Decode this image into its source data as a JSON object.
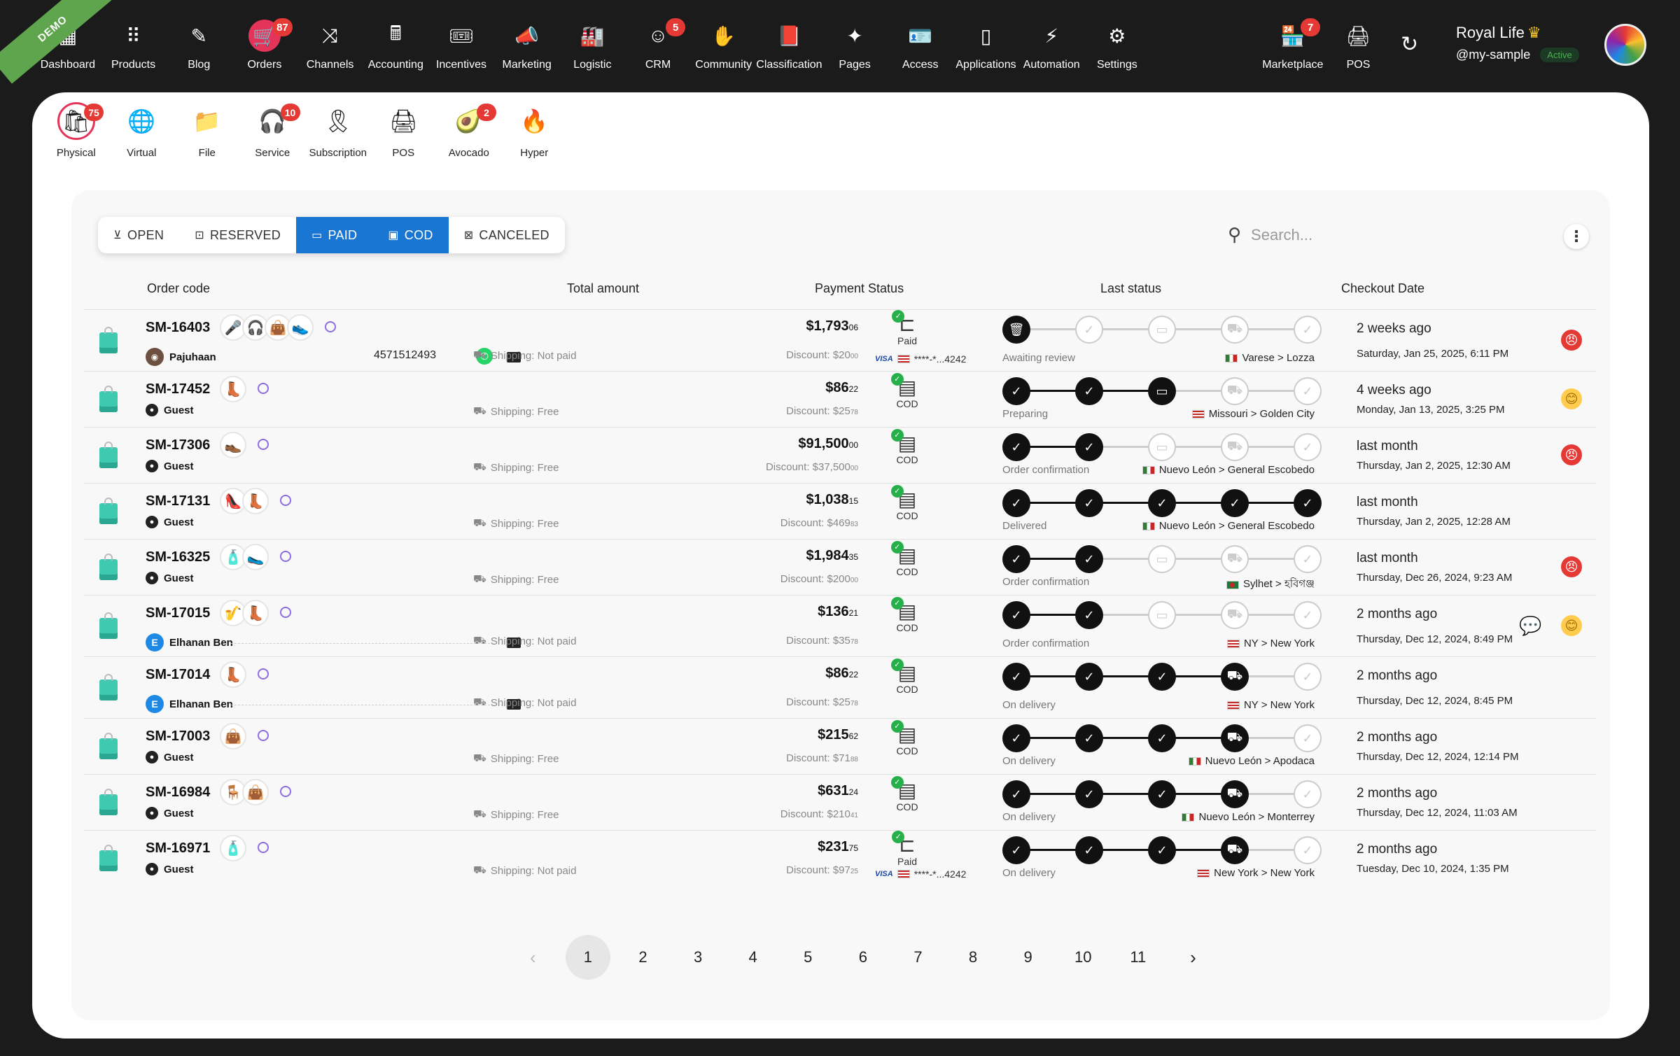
{
  "demo_label": "DEMO",
  "nav": [
    {
      "label": "Dashboard",
      "icon": "dashboard-icon",
      "glyph": "▦"
    },
    {
      "label": "Products",
      "icon": "products-icon",
      "glyph": "⠿"
    },
    {
      "label": "Blog",
      "icon": "blog-icon",
      "glyph": "✎"
    },
    {
      "label": "Orders",
      "icon": "cart-icon",
      "glyph": "🛒",
      "badge": "87",
      "active": true
    },
    {
      "label": "Channels",
      "icon": "channels-icon",
      "glyph": "⤨"
    },
    {
      "label": "Accounting",
      "icon": "calculator-icon",
      "glyph": "🖩"
    },
    {
      "label": "Incentives",
      "icon": "ticket-icon",
      "glyph": "🎟"
    },
    {
      "label": "Marketing",
      "icon": "megaphone-icon",
      "glyph": "📣"
    },
    {
      "label": "Logistic",
      "icon": "warehouse-icon",
      "glyph": "🏭"
    },
    {
      "label": "CRM",
      "icon": "crm-icon",
      "glyph": "☺",
      "badge": "5"
    },
    {
      "label": "Community",
      "icon": "community-icon",
      "glyph": "✋"
    },
    {
      "label": "Classification",
      "icon": "book-icon",
      "glyph": "📕"
    },
    {
      "label": "Pages",
      "icon": "pages-icon",
      "glyph": "✦"
    },
    {
      "label": "Access",
      "icon": "access-icon",
      "glyph": "🪪"
    },
    {
      "label": "Applications",
      "icon": "phone-icon",
      "glyph": "▯"
    },
    {
      "label": "Automation",
      "icon": "automation-icon",
      "glyph": "⚡"
    },
    {
      "label": "Settings",
      "icon": "gear-icon",
      "glyph": "⚙"
    }
  ],
  "nav_right": [
    {
      "label": "Marketplace",
      "icon": "marketplace-icon",
      "glyph": "🏪",
      "badge": "7"
    },
    {
      "label": "POS",
      "icon": "pos-icon",
      "glyph": "🖨"
    }
  ],
  "user": {
    "name": "Royal Life",
    "handle": "@my-sample",
    "status": "Active"
  },
  "subnav": [
    {
      "label": "Physical",
      "icon": "physical-icon",
      "glyph": "🛍",
      "badge": "75",
      "active": true
    },
    {
      "label": "Virtual",
      "icon": "globe-icon",
      "glyph": "🌐"
    },
    {
      "label": "File",
      "icon": "file-icon",
      "glyph": "📁"
    },
    {
      "label": "Service",
      "icon": "headset-icon",
      "glyph": "🎧",
      "badge": "10"
    },
    {
      "label": "Subscription",
      "icon": "ribbon-icon",
      "glyph": "🎗"
    },
    {
      "label": "POS",
      "icon": "pos-terminal-icon",
      "glyph": "🖨"
    },
    {
      "label": "Avocado",
      "icon": "avocado-icon",
      "glyph": "🥑",
      "badge": "2"
    },
    {
      "label": "Hyper",
      "icon": "hyper-icon",
      "glyph": "🔥"
    }
  ],
  "filters": [
    {
      "label": "OPEN",
      "icon": "inbox-icon",
      "glyph": "⊻",
      "active": false
    },
    {
      "label": "RESERVED",
      "icon": "reserved-icon",
      "glyph": "⊡",
      "active": false
    },
    {
      "label": "PAID",
      "icon": "credit-card-icon",
      "glyph": "▭",
      "active": true
    },
    {
      "label": "COD",
      "icon": "cash-icon",
      "glyph": "▣",
      "active": true
    },
    {
      "label": "CANCELED",
      "icon": "cancel-icon",
      "glyph": "⊠",
      "active": false
    }
  ],
  "search": {
    "placeholder": "Search..."
  },
  "columns": {
    "order": "Order code",
    "amount": "Total amount",
    "payment": "Payment Status",
    "status": "Last status",
    "date": "Checkout Date"
  },
  "orders": [
    {
      "code": "SM-16403",
      "thumbs": [
        "🎤",
        "🎧",
        "👜",
        "👟"
      ],
      "customer": "Pajuhaan",
      "cust_type": "photo",
      "phone": "4571512493",
      "whatsapp": true,
      "mail": true,
      "shipping": "Shipping: Not paid",
      "amount": "$1,793",
      "amount_cents": "06",
      "discount": "Discount: $20",
      "discount_cents": "00",
      "payment": "Paid",
      "card": "****-*...4242",
      "steps_done": 1,
      "active_step": 1,
      "status": "Awaiting review",
      "flag": "it",
      "route": "Varese > Lozza",
      "ago": "2 weeks ago",
      "date": "Saturday, Jan 25, 2025, 6:11 PM",
      "mood": "angry",
      "chat": false
    },
    {
      "code": "SM-17452",
      "thumbs": [
        "👢"
      ],
      "customer": "Guest",
      "cust_type": "guest",
      "shipping": "Shipping: Free",
      "amount": "$86",
      "amount_cents": "22",
      "discount": "Discount: $25",
      "discount_cents": "78",
      "payment": "COD",
      "steps_done": 3,
      "active_step": 3,
      "status": "Preparing",
      "flag": "us",
      "route": "Missouri > Golden City",
      "ago": "4 weeks ago",
      "date": "Monday, Jan 13, 2025, 3:25 PM",
      "mood": "neutral",
      "chat": false
    },
    {
      "code": "SM-17306",
      "thumbs": [
        "👞"
      ],
      "customer": "Guest",
      "cust_type": "guest",
      "shipping": "Shipping: Free",
      "amount": "$91,500",
      "amount_cents": "00",
      "discount": "Discount: $37,500",
      "discount_cents": "00",
      "payment": "COD",
      "steps_done": 2,
      "active_step": 2,
      "status": "Order confirmation",
      "flag": "mx",
      "route": "Nuevo León > General Escobedo",
      "ago": "last month",
      "date": "Thursday, Jan 2, 2025, 12:30 AM",
      "mood": "angry",
      "chat": false
    },
    {
      "code": "SM-17131",
      "thumbs": [
        "👠",
        "👢"
      ],
      "customer": "Guest",
      "cust_type": "guest",
      "shipping": "Shipping: Free",
      "amount": "$1,038",
      "amount_cents": "15",
      "discount": "Discount: $469",
      "discount_cents": "83",
      "payment": "COD",
      "steps_done": 5,
      "active_step": 5,
      "status": "Delivered",
      "flag": "mx",
      "route": "Nuevo León > General Escobedo",
      "ago": "last month",
      "date": "Thursday, Jan 2, 2025, 12:28 AM",
      "mood": "",
      "chat": false
    },
    {
      "code": "SM-16325",
      "thumbs": [
        "🧴",
        "🥿"
      ],
      "customer": "Guest",
      "cust_type": "guest",
      "shipping": "Shipping: Free",
      "amount": "$1,984",
      "amount_cents": "35",
      "discount": "Discount: $200",
      "discount_cents": "00",
      "payment": "COD",
      "steps_done": 2,
      "active_step": 2,
      "status": "Order confirmation",
      "flag": "bd",
      "route": "Sylhet > হবিগঞ্জ",
      "ago": "last month",
      "date": "Thursday, Dec 26, 2024, 9:23 AM",
      "mood": "angry",
      "chat": false
    },
    {
      "code": "SM-17015",
      "thumbs": [
        "🎷",
        "👢"
      ],
      "customer": "Elhanan Ben",
      "cust_type": "letter",
      "mail": true,
      "shipping": "Shipping: Not paid",
      "amount": "$136",
      "amount_cents": "21",
      "discount": "Discount: $35",
      "discount_cents": "78",
      "payment": "COD",
      "steps_done": 2,
      "active_step": 2,
      "status": "Order confirmation",
      "flag": "us",
      "route": "NY > New York",
      "ago": "2 months ago",
      "date": "Thursday, Dec 12, 2024, 8:49 PM",
      "mood": "neutral",
      "chat": true
    },
    {
      "code": "SM-17014",
      "thumbs": [
        "👢"
      ],
      "customer": "Elhanan Ben",
      "cust_type": "letter",
      "mail": true,
      "shipping": "Shipping: Not paid",
      "amount": "$86",
      "amount_cents": "22",
      "discount": "Discount: $25",
      "discount_cents": "78",
      "payment": "COD",
      "steps_done": 4,
      "active_step": 4,
      "status": "On delivery",
      "flag": "us",
      "route": "NY > New York",
      "ago": "2 months ago",
      "date": "Thursday, Dec 12, 2024, 8:45 PM",
      "mood": "",
      "chat": false
    },
    {
      "code": "SM-17003",
      "thumbs": [
        "👜"
      ],
      "customer": "Guest",
      "cust_type": "guest",
      "shipping": "Shipping: Free",
      "amount": "$215",
      "amount_cents": "62",
      "discount": "Discount: $71",
      "discount_cents": "88",
      "payment": "COD",
      "steps_done": 4,
      "active_step": 4,
      "status": "On delivery",
      "flag": "mx",
      "route": "Nuevo León > Apodaca",
      "ago": "2 months ago",
      "date": "Thursday, Dec 12, 2024, 12:14 PM",
      "mood": "",
      "chat": false
    },
    {
      "code": "SM-16984",
      "thumbs": [
        "🪑",
        "👜"
      ],
      "customer": "Guest",
      "cust_type": "guest",
      "shipping": "Shipping: Free",
      "amount": "$631",
      "amount_cents": "24",
      "discount": "Discount: $210",
      "discount_cents": "41",
      "payment": "COD",
      "steps_done": 4,
      "active_step": 4,
      "status": "On delivery",
      "flag": "mx",
      "route": "Nuevo León > Monterrey",
      "ago": "2 months ago",
      "date": "Thursday, Dec 12, 2024, 11:03 AM",
      "mood": "",
      "chat": false
    },
    {
      "code": "SM-16971",
      "thumbs": [
        "🧴"
      ],
      "customer": "Guest",
      "cust_type": "guest",
      "shipping": "Shipping: Not paid",
      "amount": "$231",
      "amount_cents": "75",
      "discount": "Discount: $97",
      "discount_cents": "25",
      "payment": "Paid",
      "card": "****-*...4242",
      "steps_done": 4,
      "active_step": 4,
      "status": "On delivery",
      "flag": "us",
      "route": "New York > New York",
      "ago": "2 months ago",
      "date": "Tuesday, Dec 10, 2024, 1:35 PM",
      "mood": "",
      "chat": false
    }
  ],
  "pagination": {
    "current": "1",
    "pages": [
      "1",
      "2",
      "3",
      "4",
      "5",
      "6",
      "7",
      "8",
      "9",
      "10",
      "11"
    ],
    "prev": "‹",
    "next": "›"
  }
}
